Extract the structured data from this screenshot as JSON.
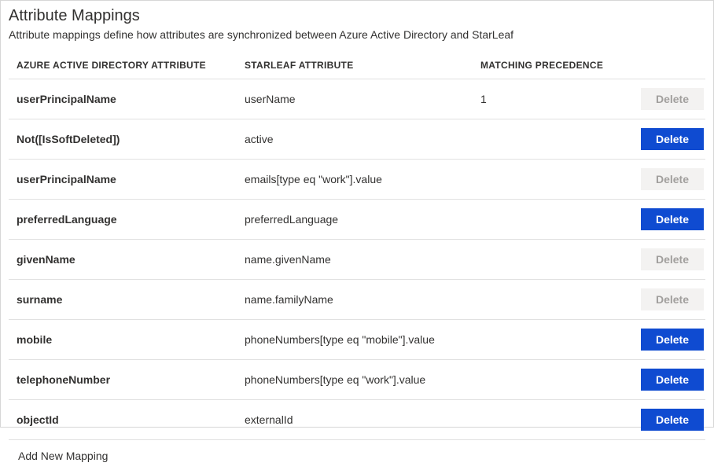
{
  "title": "Attribute Mappings",
  "subtitle": "Attribute mappings define how attributes are synchronized between Azure Active Directory and StarLeaf",
  "headers": {
    "aad": "AZURE ACTIVE DIRECTORY ATTRIBUTE",
    "starleaf": "STARLEAF ATTRIBUTE",
    "matching": "MATCHING PRECEDENCE"
  },
  "rows": [
    {
      "aad": "userPrincipalName",
      "starleaf": "userName",
      "matching": "1",
      "deleteEnabled": false
    },
    {
      "aad": "Not([IsSoftDeleted])",
      "starleaf": "active",
      "matching": "",
      "deleteEnabled": true
    },
    {
      "aad": "userPrincipalName",
      "starleaf": "emails[type eq \"work\"].value",
      "matching": "",
      "deleteEnabled": false
    },
    {
      "aad": "preferredLanguage",
      "starleaf": "preferredLanguage",
      "matching": "",
      "deleteEnabled": true
    },
    {
      "aad": "givenName",
      "starleaf": "name.givenName",
      "matching": "",
      "deleteEnabled": false
    },
    {
      "aad": "surname",
      "starleaf": "name.familyName",
      "matching": "",
      "deleteEnabled": false
    },
    {
      "aad": "mobile",
      "starleaf": "phoneNumbers[type eq \"mobile\"].value",
      "matching": "",
      "deleteEnabled": true
    },
    {
      "aad": "telephoneNumber",
      "starleaf": "phoneNumbers[type eq \"work\"].value",
      "matching": "",
      "deleteEnabled": true
    },
    {
      "aad": "objectId",
      "starleaf": "externalId",
      "matching": "",
      "deleteEnabled": true
    }
  ],
  "deleteLabel": "Delete",
  "addNewLabel": "Add New Mapping"
}
